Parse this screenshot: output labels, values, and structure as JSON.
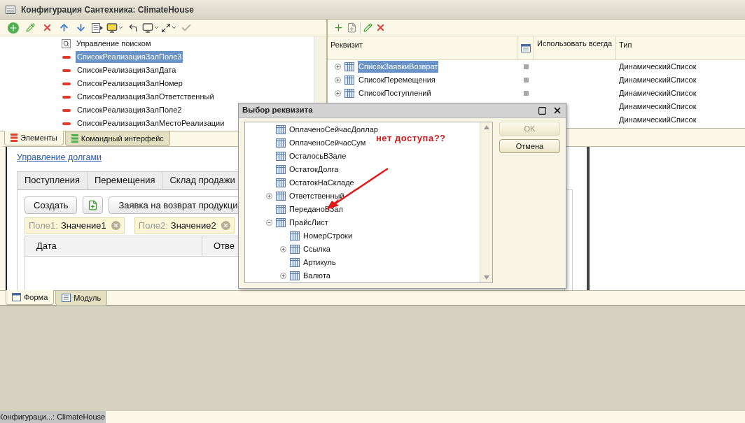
{
  "window": {
    "title": "Конфигурация Сантехника: ClimateHouse"
  },
  "elements_tree": [
    {
      "kind": "search",
      "label": "Управление поиском",
      "selected": false
    },
    {
      "kind": "field",
      "label": "СписокРеализацияЗалПоле3",
      "selected": true
    },
    {
      "kind": "field",
      "label": "СписокРеализацияЗалДата",
      "selected": false
    },
    {
      "kind": "field",
      "label": "СписокРеализацияЗалНомер",
      "selected": false
    },
    {
      "kind": "field",
      "label": "СписокРеализацияЗалОтветственный",
      "selected": false
    },
    {
      "kind": "field",
      "label": "СписокРеализацияЗалПоле2",
      "selected": false
    },
    {
      "kind": "field",
      "label": "СписокРеализацияЗалМестоРеализации",
      "selected": false
    }
  ],
  "left_tabs": [
    {
      "label": "Элементы",
      "selected": true
    },
    {
      "label": "Командный интерфейс",
      "selected": false
    }
  ],
  "attributes_table": {
    "columns": [
      "Реквизит",
      "Использовать всегда",
      "Тип"
    ],
    "rows": [
      {
        "name": "СписокЗаявкиВозврат",
        "selected": true,
        "expanded": false,
        "use_always": false,
        "type": "ДинамическийСписок"
      },
      {
        "name": "СписокПеремещения",
        "selected": false,
        "expanded": false,
        "use_always": false,
        "type": "ДинамическийСписок"
      },
      {
        "name": "СписокПоступлений",
        "selected": false,
        "expanded": false,
        "use_always": false,
        "type": "ДинамическийСписок"
      },
      {
        "type": "ДинамическийСписок"
      },
      {
        "type": "ДинамическийСписок"
      }
    ]
  },
  "form_preview": {
    "link": "Управление долгами",
    "tabs": [
      "Поступления",
      "Перемещения",
      "Склад продажи"
    ],
    "buttons": [
      "Создать",
      "Заявка на возврат продукци"
    ],
    "filters": [
      {
        "field": "Поле1:",
        "value": "Значение1"
      },
      {
        "field": "Поле2:",
        "value": "Значение2"
      }
    ],
    "columns": [
      "Дата",
      "Отве"
    ]
  },
  "bottom_tabs": [
    {
      "label": "Форма",
      "selected": true
    },
    {
      "label": "Модуль",
      "selected": false
    }
  ],
  "dialog": {
    "title": "Выбор реквизита",
    "tree": [
      {
        "label": "ОплаченоСейчасДоллар"
      },
      {
        "label": "ОплаченоСейчасСум"
      },
      {
        "label": "ОсталосьВЗале"
      },
      {
        "label": "ОстатокДолга"
      },
      {
        "label": "ОстатокНаСкладе"
      },
      {
        "label": "Ответственный",
        "expanded": false
      },
      {
        "label": "ПереданоВЗал"
      },
      {
        "label": "ПрайсЛист",
        "expanded": true,
        "children": [
          {
            "label": "НомерСтроки"
          },
          {
            "label": "Ссылка",
            "expanded": false
          },
          {
            "label": "Артикуль"
          },
          {
            "label": "Валюта",
            "expanded": false
          }
        ]
      }
    ],
    "buttons": [
      {
        "label": "OK",
        "disabled": true
      },
      {
        "label": "Отмена",
        "disabled": false
      }
    ],
    "annotation": "нет доступа??"
  },
  "taskbar": {
    "items": [
      "Конфигураци...: ClimateHouse"
    ]
  }
}
